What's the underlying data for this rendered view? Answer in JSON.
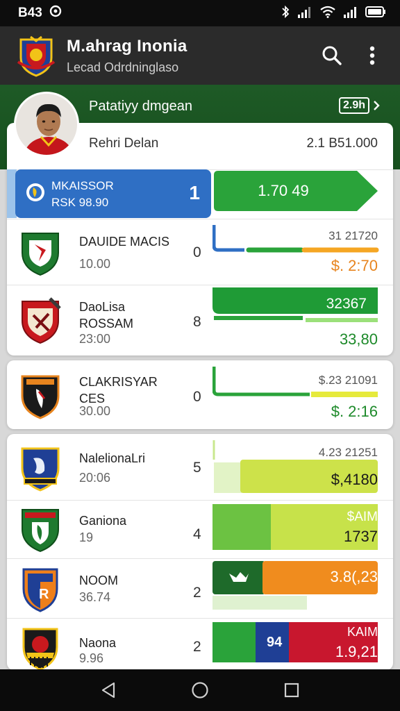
{
  "status_bar": {
    "time": "B43"
  },
  "app_bar": {
    "title": "M.ahrag Inonia",
    "subtitle": "Lecad Odrdninglaso"
  },
  "featured": {
    "title": "Patatiyy dmgean",
    "badge": "2.9h",
    "player_name": "Rehri Delan",
    "amount": "2.1 B51.000"
  },
  "highlight_row": {
    "name": "MKAISSOR",
    "sub": "RSK 98.90",
    "count": "1",
    "value": "1.70 49",
    "colors": {
      "blue": "#2f6fc4",
      "green": "#2aa33a"
    }
  },
  "rows": [
    {
      "name": "DAUIDE MACIS",
      "time": "10.00",
      "count": "0",
      "small": "31 21720",
      "money": "$. 2:70",
      "money_color": "#e7841e"
    },
    {
      "name": "DaoLisa\nROSSAM",
      "time": "23:00",
      "count": "8",
      "small": "32367",
      "money": "33,80",
      "money_color": "#1d8a2a"
    },
    {
      "name": "CLAKRISYAR\nCES",
      "time": "30.00",
      "count": "0",
      "small": "$.23 21091",
      "money": "$. 2:16",
      "money_color": "#1d8a2a"
    },
    {
      "name": "NalelionaLri",
      "time": "20:06",
      "count": "5",
      "small": "4.23 21251",
      "money": "$,4180",
      "money_color": "#1a1a1a"
    },
    {
      "name": "Ganiona",
      "time": "19",
      "count": "4",
      "small": "$AIM",
      "money": "1737",
      "money_color": "#1a1a1a"
    },
    {
      "name": "NOOM",
      "time": "36.74",
      "count": "2",
      "small": "",
      "money": "3.8(,23",
      "money_color": "#ffffff"
    },
    {
      "name": "Naona",
      "time": "9.96",
      "count": "2",
      "small": "KAIM",
      "money": "1.9,21",
      "money_color": "#ffffff"
    }
  ],
  "extra": {
    "noom_bar_label": "",
    "naona_bar_label": "94"
  }
}
